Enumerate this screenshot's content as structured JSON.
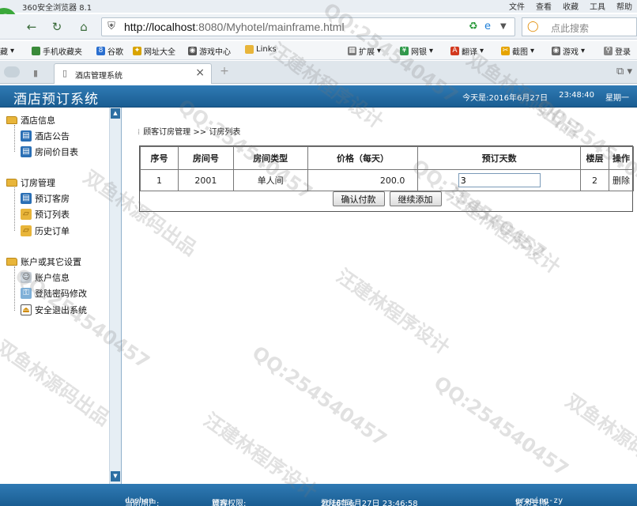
{
  "browser": {
    "title": "360安全浏览器 8.1",
    "menus": [
      "文件",
      "查看",
      "收藏",
      "工具",
      "帮助"
    ],
    "url_host": "http://localhost",
    "url_path": ":8080/Myhotel/mainframe.html",
    "search_placeholder": "点此搜索",
    "bookmarks": [
      "藏",
      "手机收藏夹",
      "谷歌",
      "网址大全",
      "游戏中心",
      "Links"
    ],
    "toolbar_extras": [
      "扩展",
      "网银",
      "翻译",
      "截图",
      "游戏",
      "登录"
    ],
    "tab_label": "酒店管理系统"
  },
  "header": {
    "system_name": "酒店预订系统",
    "date_text": "今天是:2016年6月27日",
    "time_text": "23:48:40",
    "weekday": "星期一"
  },
  "sidebar": {
    "groups": [
      {
        "label": "酒店信息",
        "items": [
          "酒店公告",
          "房间价目表"
        ]
      },
      {
        "label": "订房管理",
        "items": [
          "预订客房",
          "预订列表",
          "历史订单"
        ]
      },
      {
        "label": "账户或其它设置",
        "items": [
          "账户信息",
          "登陆密码修改",
          "安全退出系统"
        ]
      }
    ]
  },
  "main": {
    "breadcrumb_section": "顾客订房管理",
    "breadcrumb_sep": ">>",
    "breadcrumb_page": "订房列表",
    "columns": [
      "序号",
      "房间号",
      "房间类型",
      "价格（每天）",
      "预订天数",
      "楼层",
      "操作"
    ],
    "rows": [
      {
        "index": "1",
        "room_no": "2001",
        "room_type": "单人间",
        "price": "200.0",
        "days": "3",
        "floor": "2",
        "action": "删除"
      }
    ],
    "confirm_button": "确认付款",
    "continue_button": "继续添加"
  },
  "status": {
    "user_label": "当前用户:",
    "user": "dashen",
    "perm_label": "管理权限:",
    "perm": "顾客",
    "login_label": "登陆时间:",
    "login_time": "2016年6月27日 23:46:58",
    "support_label": "技术支持:",
    "support": "groping-zy"
  },
  "watermark": {
    "qq": "QQ:254540457",
    "author": "汪建林程序设计",
    "source": "双鱼林源码出品"
  },
  "colors": {
    "header_blue": "#1f679f",
    "folder_yellow": "#e8b53a"
  }
}
